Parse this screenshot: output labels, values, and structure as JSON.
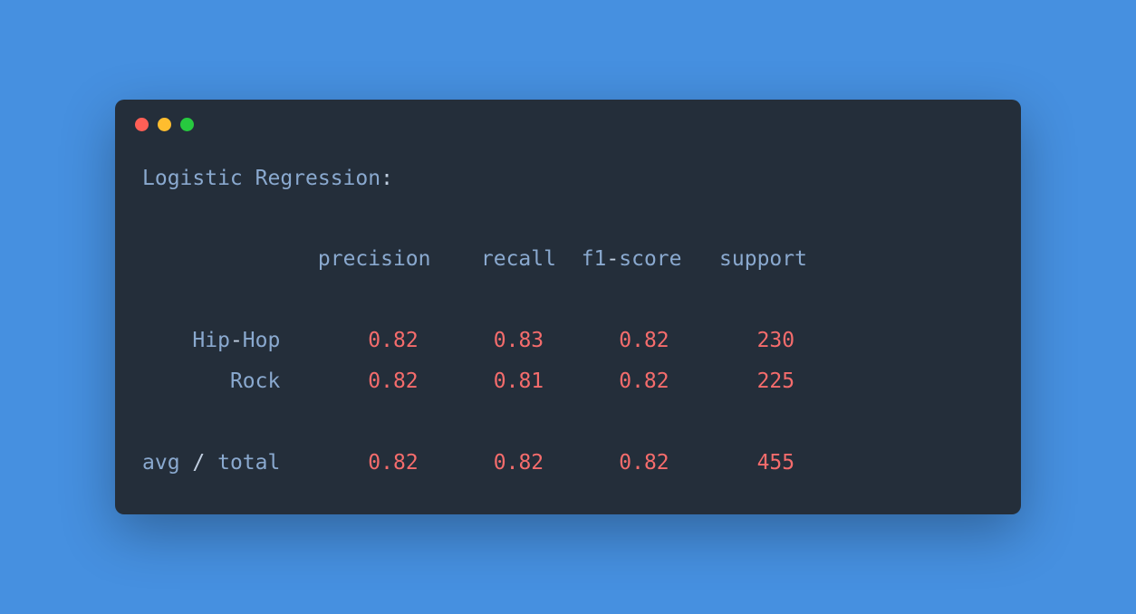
{
  "title_line": {
    "label": "Logistic Regression",
    "colon": ":"
  },
  "headers": {
    "precision": "precision",
    "recall": "recall",
    "f1": "f1",
    "dash": "-",
    "score": "score",
    "support": "support"
  },
  "rows": [
    {
      "label_pre": "Hip",
      "label_dash": "-",
      "label_post": "Hop",
      "precision": "0.82",
      "recall": "0.83",
      "f1": "0.82",
      "support": "230"
    },
    {
      "label_pre": "",
      "label_dash": "",
      "label_post": "Rock",
      "precision": "0.82",
      "recall": "0.81",
      "f1": "0.82",
      "support": "225"
    }
  ],
  "summary": {
    "avg": "avg",
    "slash": " / ",
    "total": "total",
    "precision": "0.82",
    "recall": "0.82",
    "f1": "0.82",
    "support": "455"
  }
}
